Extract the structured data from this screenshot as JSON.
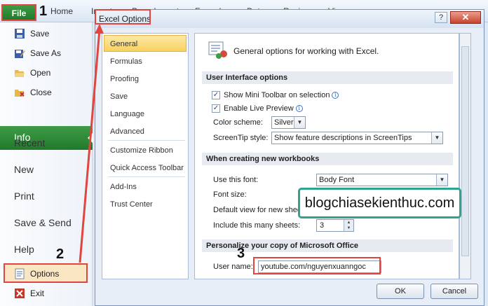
{
  "ribbon": {
    "file": "File",
    "tabs": [
      "Home",
      "Insert",
      "Page Layout",
      "Formulas",
      "Data",
      "Review",
      "View"
    ]
  },
  "backstage": {
    "small_items": [
      "Save",
      "Save As",
      "Open",
      "Close"
    ],
    "info": "Info",
    "big_items": [
      "Recent",
      "New",
      "Print",
      "Save & Send",
      "Help"
    ],
    "options": "Options",
    "exit": "Exit"
  },
  "dialog": {
    "title": "Excel Options",
    "help": "?",
    "close": "✕",
    "nav": [
      "General",
      "Formulas",
      "Proofing",
      "Save",
      "Language",
      "Advanced",
      "Customize Ribbon",
      "Quick Access Toolbar",
      "Add-Ins",
      "Trust Center"
    ],
    "header": "General options for working with Excel.",
    "ui_section": {
      "title": "User Interface options",
      "mini_toolbar": "Show Mini Toolbar on selection",
      "live_preview": "Enable Live Preview",
      "color_scheme_label": "Color scheme:",
      "color_scheme_value": "Silver",
      "screentip_label": "ScreenTip style:",
      "screentip_value": "Show feature descriptions in ScreenTips"
    },
    "workbook_section": {
      "title": "When creating new workbooks",
      "font_label": "Use this font:",
      "font_value": "Body Font",
      "size_label": "Font size:",
      "view_label": "Default view for new sheets:",
      "sheets_label": "Include this many sheets:",
      "sheets_value": "3"
    },
    "personalize_section": {
      "title": "Personalize your copy of Microsoft Office",
      "username_label": "User name:",
      "username_value": "youtube.com/nguyenxuanngoc"
    },
    "ok": "OK",
    "cancel": "Cancel"
  },
  "annotations": {
    "step1": "1",
    "step2": "2",
    "step3": "3",
    "watermark": "blogchiasekienthuc.com"
  },
  "colors": {
    "file_green": "#217a2c",
    "highlight_red": "#e0463f",
    "callout_teal": "#2fa38d",
    "nav_selected": "#f9d15f"
  }
}
